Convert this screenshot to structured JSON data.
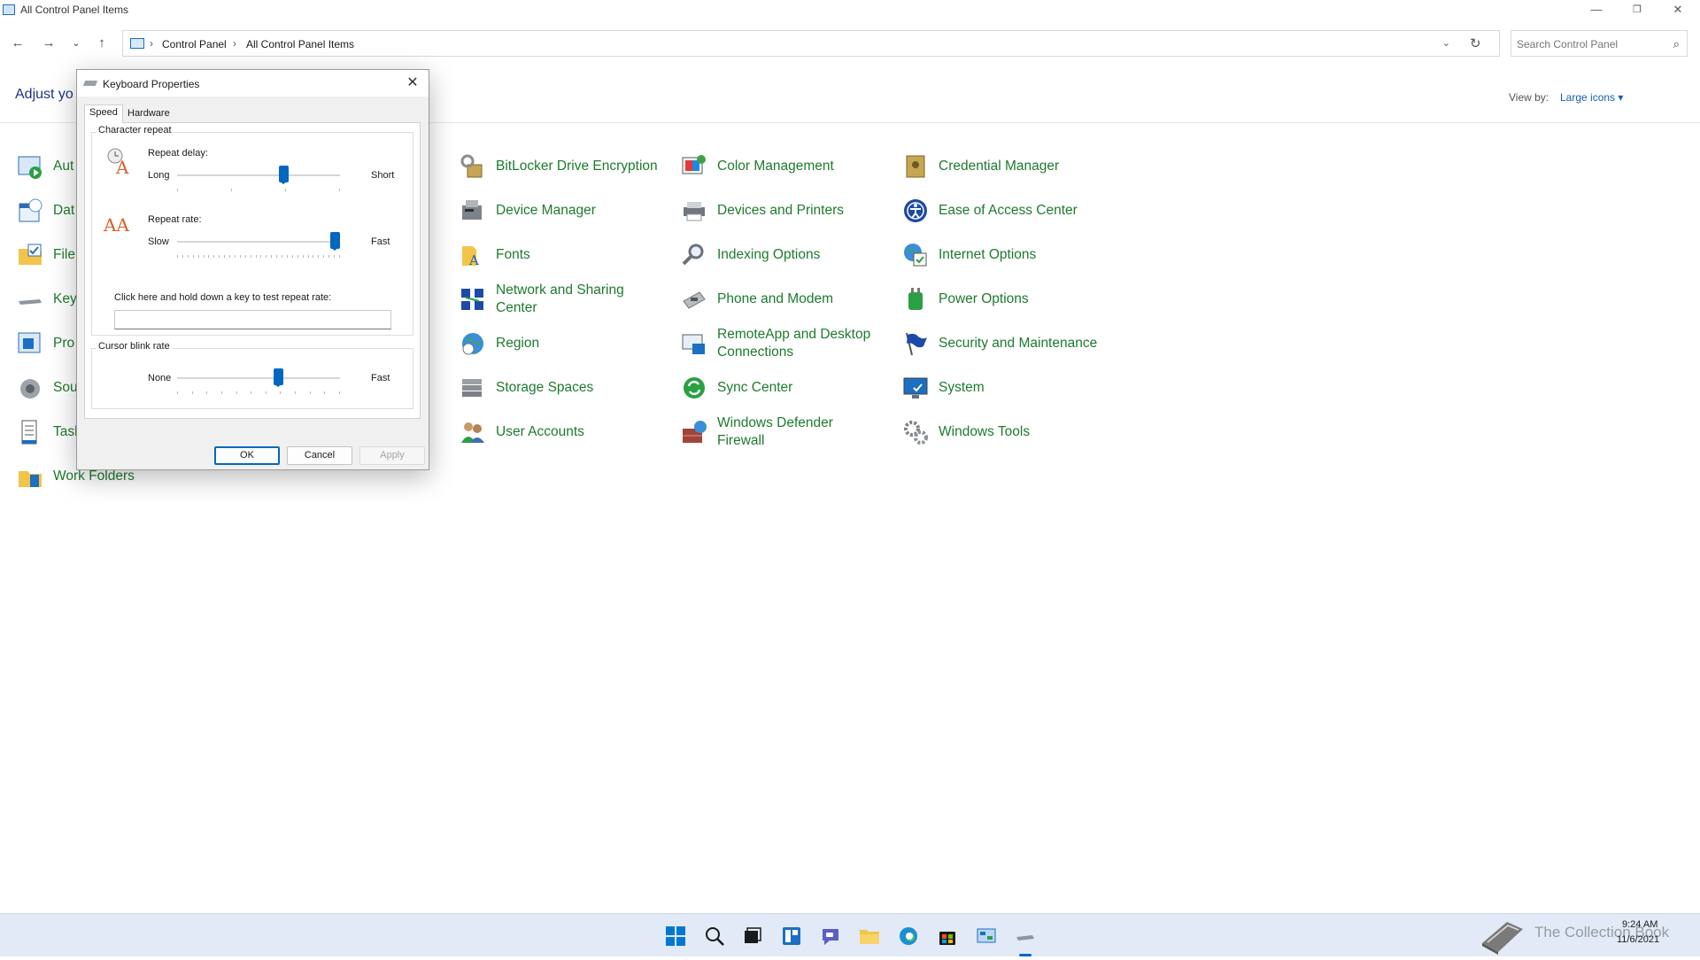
{
  "window": {
    "title": "All Control Panel Items",
    "minimize_glyph": "—",
    "restore_glyph": "❐",
    "close_glyph": "✕"
  },
  "nav": {
    "back": "←",
    "forward": "→",
    "recent": "⌄",
    "up": "↑",
    "breadcrumb": [
      "Control Panel",
      "All Control Panel Items"
    ],
    "refresh": "↻",
    "search_placeholder": "Search Control Panel"
  },
  "header": {
    "adjust_text": "Adjust yo",
    "view_by_label": "View by:",
    "view_by_value": "Large icons ▾"
  },
  "left_column_partial": [
    "Aut",
    "Dat",
    "File",
    "Key",
    "Pro",
    "Sou",
    "Task"
  ],
  "work_folders": "Work Folders",
  "items": {
    "col1": [
      "BitLocker Drive Encryption",
      "Device Manager",
      "Fonts",
      "Network and Sharing Center",
      "Region",
      "Storage Spaces",
      "User Accounts"
    ],
    "col2": [
      "Color Management",
      "Devices and Printers",
      "Indexing Options",
      "Phone and Modem",
      "RemoteApp and Desktop Connections",
      "Sync Center",
      "Windows Defender Firewall"
    ],
    "col3": [
      "Credential Manager",
      "Ease of Access Center",
      "Internet Options",
      "Power Options",
      "Security and Maintenance",
      "System",
      "Windows Tools"
    ]
  },
  "dialog": {
    "title": "Keyboard Properties",
    "close_glyph": "✕",
    "tabs": [
      "Speed",
      "Hardware"
    ],
    "character_repeat": {
      "group_label": "Character repeat",
      "repeat_delay_label": "Repeat delay:",
      "delay_left": "Long",
      "delay_right": "Short",
      "delay_value": 0.65,
      "repeat_rate_label": "Repeat rate:",
      "rate_left": "Slow",
      "rate_right": "Fast",
      "rate_value": 0.97,
      "test_label": "Click here and hold down a key to test repeat rate:"
    },
    "cursor_blink": {
      "group_label": "Cursor blink rate",
      "left": "None",
      "right": "Fast",
      "value": 0.62
    },
    "buttons": {
      "ok": "OK",
      "cancel": "Cancel",
      "apply": "Apply"
    }
  },
  "taskbar": {
    "tray_text": "The Collection Book",
    "time": "9:24 AM",
    "date": "11/6/2021"
  }
}
